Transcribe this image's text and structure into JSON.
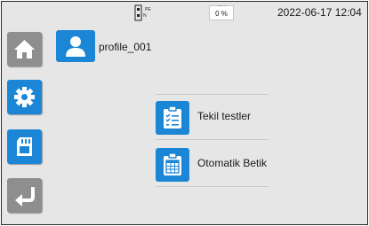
{
  "status": {
    "datetime": "2022-06-17   12:04",
    "battery_level": "0 %",
    "power_plug_label": "PE",
    "power_plug_sub": "N"
  },
  "sidebar": {
    "items": [
      {
        "icon": "home-icon",
        "state": "inactive"
      },
      {
        "icon": "gear-icon",
        "state": "active"
      },
      {
        "icon": "sd-card-icon",
        "state": "active"
      },
      {
        "icon": "back-arrow-icon",
        "state": "inactive"
      }
    ]
  },
  "profile": {
    "name": "profile_001",
    "icon": "user-icon"
  },
  "menu": {
    "items": [
      {
        "label": "Tekil testler",
        "icon": "clipboard-checklist-icon"
      },
      {
        "label": "Otomatik Betik",
        "icon": "clipboard-table-icon"
      }
    ]
  },
  "colors": {
    "accent": "#1b86d6",
    "inactive_button": "#8e8e8e",
    "background": "#e6e6e6"
  }
}
